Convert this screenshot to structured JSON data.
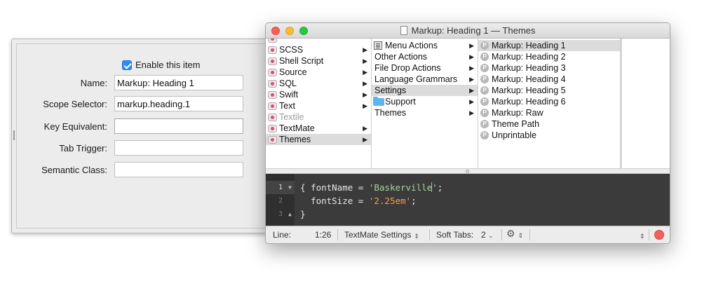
{
  "inspector": {
    "enable_label": "Enable this item",
    "fields": [
      {
        "label": "Name:",
        "value": "Markup: Heading 1"
      },
      {
        "label": "Scope Selector:",
        "value": "markup.heading.1"
      },
      {
        "label": "Key Equivalent:",
        "value": ""
      },
      {
        "label": "Tab Trigger:",
        "value": ""
      },
      {
        "label": "Semantic Class:",
        "value": ""
      }
    ]
  },
  "window": {
    "title": "Markup: Heading 1 — Themes",
    "col1": [
      {
        "label": "SCSS"
      },
      {
        "label": "Shell Script"
      },
      {
        "label": "Source"
      },
      {
        "label": "SQL"
      },
      {
        "label": "Swift"
      },
      {
        "label": "Text"
      },
      {
        "label": "Textile"
      },
      {
        "label": "TextMate"
      },
      {
        "label": "Themes"
      }
    ],
    "col2": [
      {
        "label": "Menu Actions"
      },
      {
        "label": "Other Actions"
      },
      {
        "label": "File Drop Actions"
      },
      {
        "label": "Language Grammars"
      },
      {
        "label": "Settings"
      },
      {
        "label": "Support"
      },
      {
        "label": "Themes"
      }
    ],
    "col3": [
      {
        "label": "Markup: Heading 1",
        "badge": "P"
      },
      {
        "label": "Markup: Heading 2",
        "badge": "P"
      },
      {
        "label": "Markup: Heading 3",
        "badge": "P"
      },
      {
        "label": "Markup: Heading 4",
        "badge": "P"
      },
      {
        "label": "Markup: Heading 5",
        "badge": "P"
      },
      {
        "label": "Markup: Heading 6",
        "badge": "P"
      },
      {
        "label": "Markup: Raw",
        "badge": "P"
      },
      {
        "label": "Theme Path",
        "badge": "P"
      },
      {
        "label": "Unprintable",
        "badge": "P"
      }
    ],
    "editor": {
      "line_numbers": [
        "1",
        "2",
        "3"
      ],
      "lines": [
        {
          "open": "{ fontName = ",
          "string_pre": "'Baskerville",
          "string_post": "'",
          "close": ";"
        },
        {
          "indent": "  fontSize = ",
          "string": "'2.25em'",
          "close": ";"
        },
        {
          "text": "}"
        }
      ]
    },
    "status": {
      "line_label": "Line:",
      "position": "1:26",
      "grammar": "TextMate Settings",
      "tabs_label": "Soft Tabs:",
      "tabs_value": "2"
    }
  }
}
